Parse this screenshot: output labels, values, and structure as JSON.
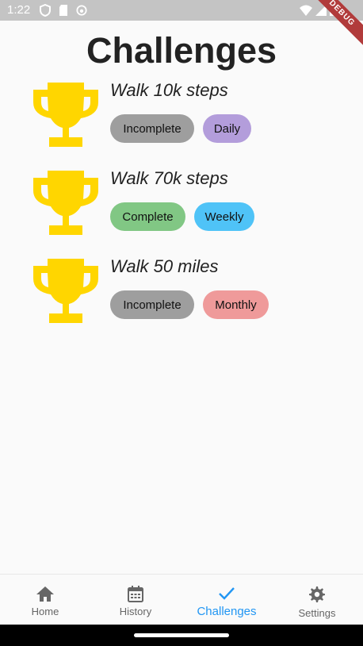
{
  "status_bar": {
    "time": "1:22",
    "left_icons": [
      "shield-icon",
      "sd-card-icon",
      "face-icon"
    ],
    "right_icons": [
      "wifi-icon",
      "signal-icon",
      "battery-icon"
    ],
    "debug_label": "DEBUG"
  },
  "page": {
    "title": "Challenges"
  },
  "challenges": [
    {
      "name": "Walk 10k steps",
      "status": "Incomplete",
      "period": "Daily",
      "status_color": "#9e9e9e",
      "period_color": "#b39ddb"
    },
    {
      "name": "Walk 70k steps",
      "status": "Complete",
      "period": "Weekly",
      "status_color": "#81c784",
      "period_color": "#4fc3f7"
    },
    {
      "name": "Walk 50 miles",
      "status": "Incomplete",
      "period": "Monthly",
      "status_color": "#9e9e9e",
      "period_color": "#ef9a9a"
    }
  ],
  "trophy_color": "#ffd600",
  "nav": {
    "items": [
      {
        "label": "Home",
        "icon": "home-icon"
      },
      {
        "label": "History",
        "icon": "calendar-icon"
      },
      {
        "label": "Challenges",
        "icon": "check-icon"
      },
      {
        "label": "Settings",
        "icon": "gear-icon"
      }
    ],
    "active": "Challenges",
    "active_color": "#2196f3",
    "inactive_color": "#666666"
  }
}
